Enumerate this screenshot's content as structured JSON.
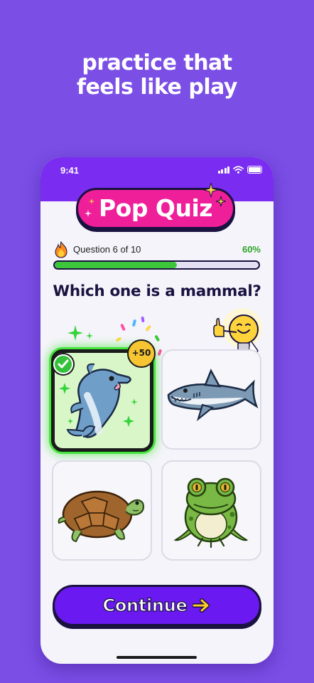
{
  "tagline": {
    "line1": "practice that",
    "line2": "feels like play"
  },
  "status_bar": {
    "time": "9:41"
  },
  "quiz": {
    "title": "Pop Quiz",
    "progress_label": "Question 6 of 10",
    "progress_percent_label": "60%",
    "progress_fraction": 0.6,
    "question": "Which one is a mammal?",
    "reward": "+50",
    "options": [
      {
        "animal": "dolphin",
        "selected": true
      },
      {
        "animal": "shark",
        "selected": false
      },
      {
        "animal": "turtle",
        "selected": false
      },
      {
        "animal": "frog",
        "selected": false
      }
    ]
  },
  "continue_button": {
    "label": "Continue"
  },
  "colors": {
    "background": "#7b4ee6",
    "header": "#7a2cf0",
    "title_pill": "#ef1f9a",
    "progress": "#3cc73a",
    "button": "#6a19f0",
    "correct": "#45e43c"
  }
}
